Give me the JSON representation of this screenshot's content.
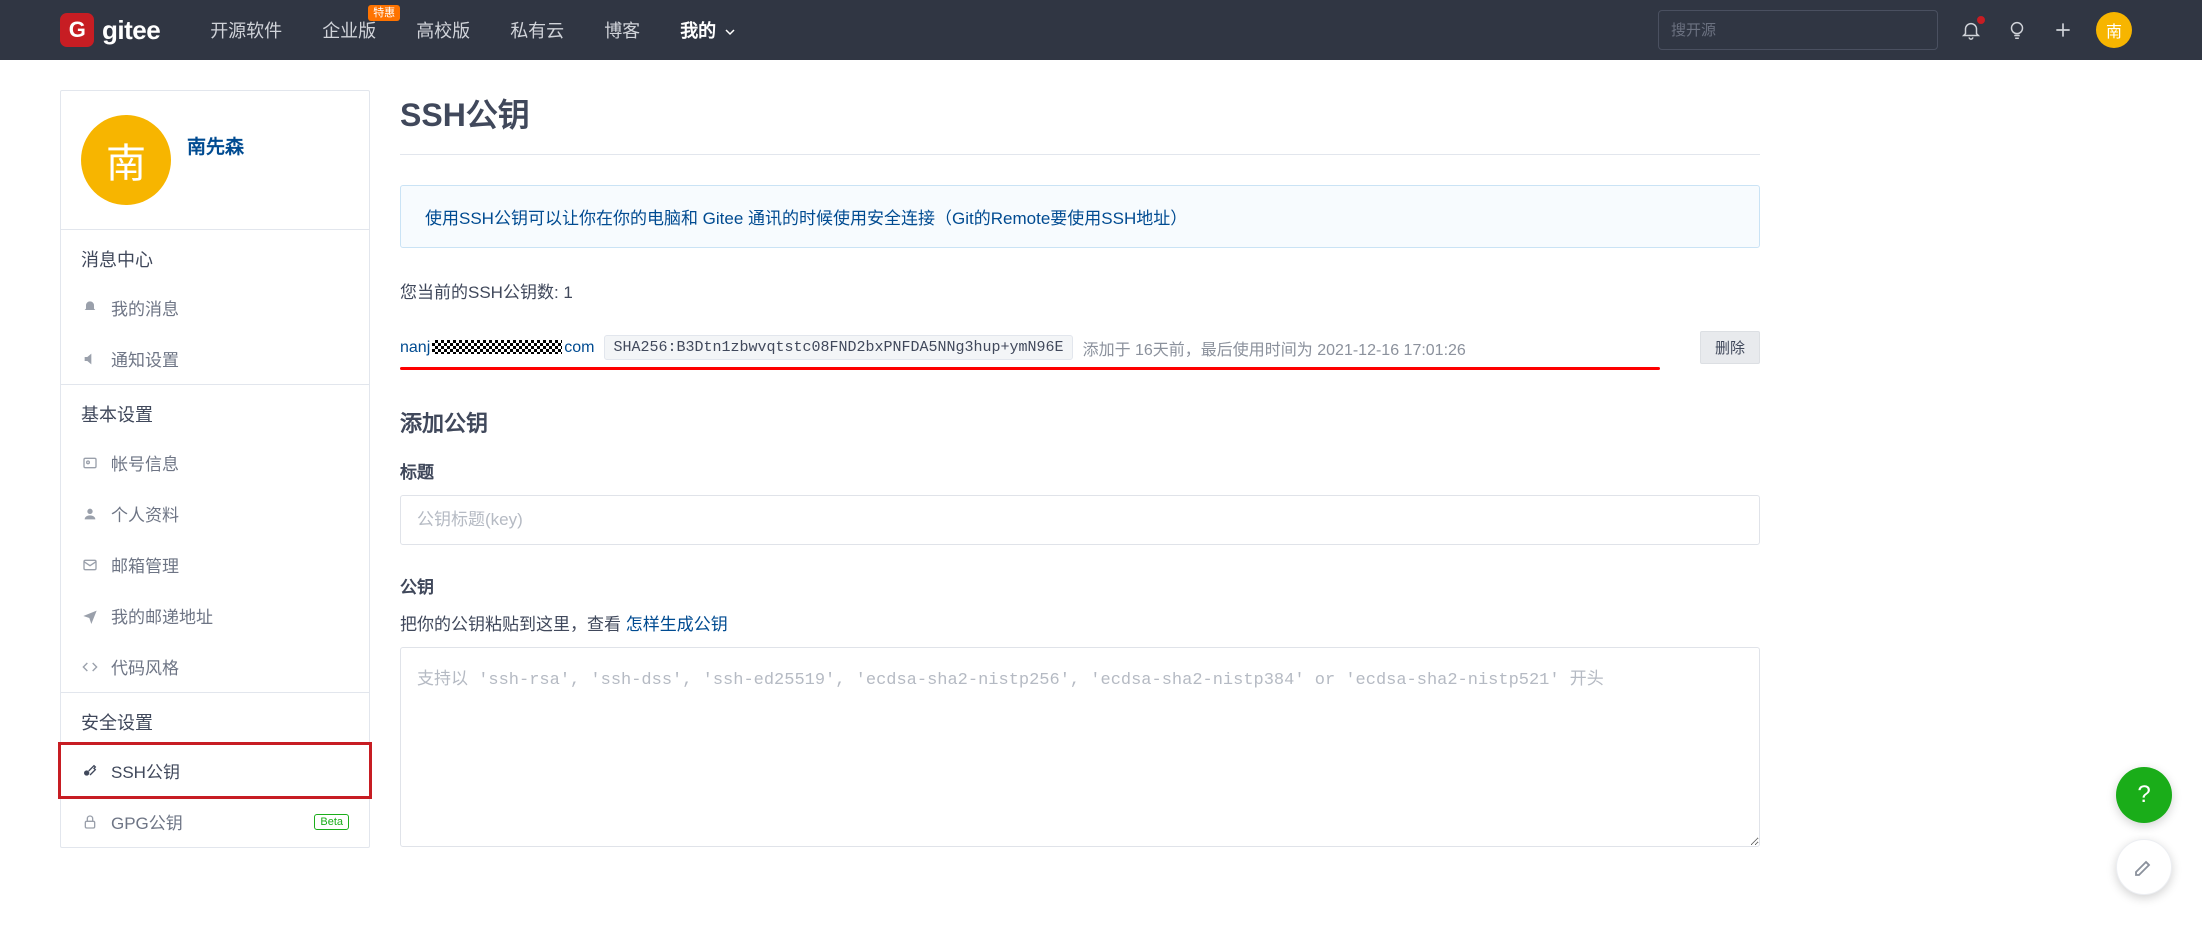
{
  "brand": "gitee",
  "nav": {
    "items": [
      {
        "label": "开源软件"
      },
      {
        "label": "企业版",
        "badge": "特惠"
      },
      {
        "label": "高校版"
      },
      {
        "label": "私有云"
      },
      {
        "label": "博客"
      },
      {
        "label": "我的",
        "caret": true,
        "active": true
      }
    ],
    "search_placeholder": "搜开源"
  },
  "user": {
    "short": "南",
    "name": "南先森"
  },
  "sidebar": {
    "sections": [
      {
        "title": "消息中心",
        "items": [
          {
            "icon": "bell",
            "label": "我的消息"
          },
          {
            "icon": "volume",
            "label": "通知设置"
          }
        ]
      },
      {
        "title": "基本设置",
        "items": [
          {
            "icon": "idcard",
            "label": "帐号信息"
          },
          {
            "icon": "user",
            "label": "个人资料"
          },
          {
            "icon": "mail",
            "label": "邮箱管理"
          },
          {
            "icon": "send",
            "label": "我的邮递地址"
          },
          {
            "icon": "code",
            "label": "代码风格"
          }
        ]
      },
      {
        "title": "安全设置",
        "items": [
          {
            "icon": "key",
            "label": "SSH公钥",
            "highlighted": true
          },
          {
            "icon": "lock",
            "label": "GPG公钥",
            "beta": "Beta"
          }
        ]
      }
    ]
  },
  "page": {
    "title": "SSH公钥",
    "info": "使用SSH公钥可以让你在你的电脑和 Gitee 通讯的时候使用安全连接（Git的Remote要使用SSH地址）",
    "count_prefix": "您当前的SSH公钥数: ",
    "count_value": "1",
    "key": {
      "email_prefix": "nanj",
      "email_suffix": "com",
      "hash": "SHA256:B3Dtn1zbwvqtstc08FND2bxPNFDA5NNg3hup+ymN96E",
      "meta": "添加于 16天前，最后使用时间为 2021-12-16 17:01:26",
      "delete": "删除"
    },
    "add": {
      "title": "添加公钥",
      "label_title": "标题",
      "placeholder_title": "公钥标题(key)",
      "label_key": "公钥",
      "hint_prefix": "把你的公钥粘贴到这里，查看 ",
      "hint_link": "怎样生成公钥",
      "placeholder_key": "支持以 'ssh-rsa', 'ssh-dss', 'ssh-ed25519', 'ecdsa-sha2-nistp256', 'ecdsa-sha2-nistp384' or 'ecdsa-sha2-nistp521' 开头"
    }
  },
  "fab": {
    "help": "?",
    "feedback": "✎"
  }
}
